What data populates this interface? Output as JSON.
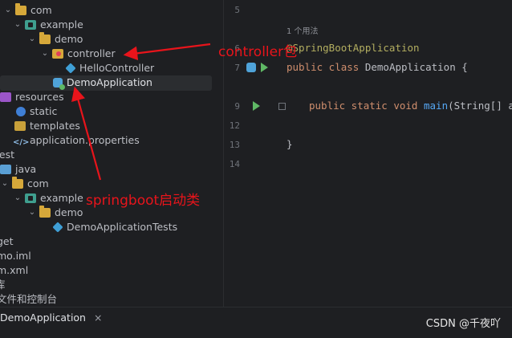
{
  "tree": {
    "items": [
      {
        "label": "com"
      },
      {
        "label": "example"
      },
      {
        "label": "demo"
      },
      {
        "label": "controller"
      },
      {
        "label": "HelloController"
      },
      {
        "label": "DemoApplication"
      },
      {
        "label": "resources"
      },
      {
        "label": "static"
      },
      {
        "label": "templates"
      },
      {
        "label": "application.properties"
      },
      {
        "label": "test"
      },
      {
        "label": "java"
      },
      {
        "label": "com"
      },
      {
        "label": "example"
      },
      {
        "label": "demo"
      },
      {
        "label": "DemoApplicationTests"
      },
      {
        "label": "get"
      },
      {
        "label": "mo.iml"
      },
      {
        "label": "m.xml"
      },
      {
        "label": "库"
      },
      {
        "label": "文件和控制台"
      }
    ]
  },
  "editor": {
    "line_numbers": [
      "5",
      "6",
      "7",
      "9",
      "12",
      "13",
      "14"
    ],
    "usage_hint": "1 个用法",
    "lines": {
      "l6": "@SpringBootApplication",
      "l7_kw": "public class ",
      "l7_name": "DemoApplication",
      "l7_rest": " {",
      "l9_kw": "public static void ",
      "l9_fn": "main",
      "l9_rest": "(String[] arg",
      "l13": "}"
    }
  },
  "annotations": {
    "controller_pkg": "controller包",
    "boot_class": "springboot启动类",
    "color": "#e8141b"
  },
  "bottom": {
    "tab_label": "DemoApplication",
    "close": "×"
  },
  "watermark": "CSDN @千夜吖"
}
